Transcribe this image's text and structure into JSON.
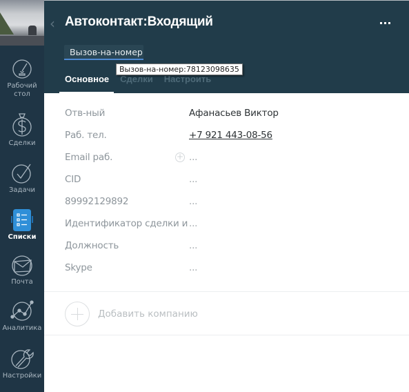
{
  "sidebar": {
    "items": [
      {
        "id": "dashboard",
        "label_line1": "Рабочий",
        "label_line2": "стол",
        "icon": "speedometer-icon",
        "active": false
      },
      {
        "id": "deals",
        "label": "Сделки",
        "icon": "money-bag-icon",
        "active": false
      },
      {
        "id": "tasks",
        "label": "Задачи",
        "icon": "checkmark-circle-icon",
        "active": false
      },
      {
        "id": "lists",
        "label": "Списки",
        "icon": "list-icon",
        "active": true
      },
      {
        "id": "mail",
        "label": "Почта",
        "icon": "envelope-icon",
        "active": false
      },
      {
        "id": "analytics",
        "label": "Аналитика",
        "icon": "analytics-icon",
        "active": false
      },
      {
        "id": "settings",
        "label": "Настройки",
        "icon": "wrench-icon",
        "active": false
      }
    ]
  },
  "header": {
    "title": "Автоконтакт:Входящий",
    "tag_value": "Вызов-на-номер",
    "tooltip": "Вызов-на-номер:78123098635",
    "tabs": [
      {
        "label": "Основное",
        "active": true
      },
      {
        "label": "Сделки",
        "active": false
      },
      {
        "label": "Настроить",
        "active": false
      }
    ],
    "more_icon": "ellipsis-icon",
    "back_icon": "chevron-left-icon"
  },
  "fields": [
    {
      "label": "Отв-ный",
      "value": "Афанасьев Виктор",
      "type": "text"
    },
    {
      "label": "Раб. тел.",
      "value": "+7 921 443-08-56",
      "type": "link"
    },
    {
      "label": "Email раб.",
      "value": "...",
      "type": "empty"
    },
    {
      "label": "CID",
      "value": "...",
      "type": "empty"
    },
    {
      "label": "89992129892",
      "value": "...",
      "type": "empty"
    },
    {
      "label": "Идентификатор сделки и",
      "value": "...",
      "type": "empty"
    },
    {
      "label": "Должность",
      "value": "...",
      "type": "empty"
    },
    {
      "label": "Skype",
      "value": "...",
      "type": "empty"
    }
  ],
  "add_company": {
    "label": "Добавить компанию"
  },
  "colors": {
    "sidebar_bg": "#1f3545",
    "header_bg": "#213c4a",
    "accent_blue": "#2f8fd8",
    "tag_underline": "#4e8ad4"
  }
}
